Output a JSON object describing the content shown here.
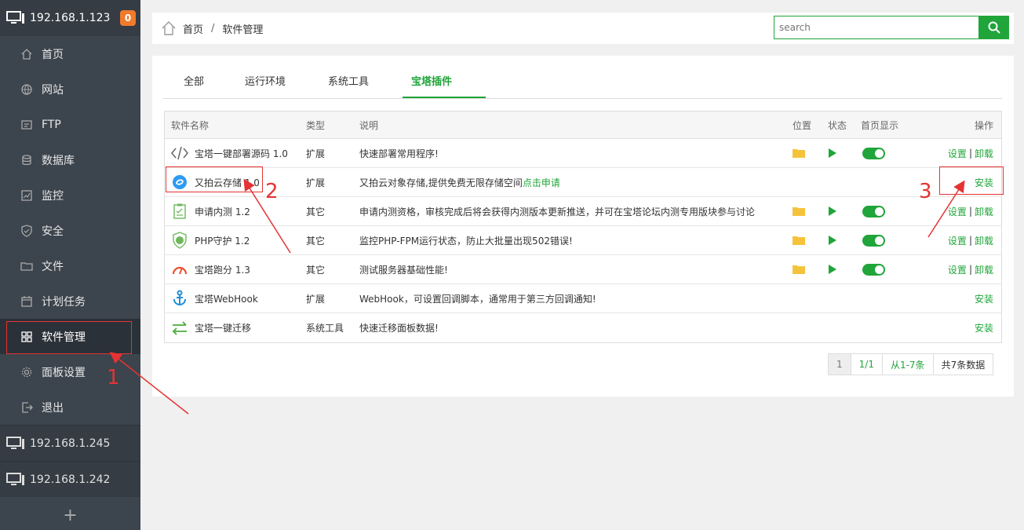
{
  "sidebar": {
    "current_server": "192.168.1.123",
    "badge": "0",
    "items": [
      {
        "label": "首页"
      },
      {
        "label": "网站"
      },
      {
        "label": "FTP"
      },
      {
        "label": "数据库"
      },
      {
        "label": "监控"
      },
      {
        "label": "安全"
      },
      {
        "label": "文件"
      },
      {
        "label": "计划任务"
      },
      {
        "label": "软件管理"
      },
      {
        "label": "面板设置"
      },
      {
        "label": "退出"
      }
    ],
    "other_servers": [
      "192.168.1.245",
      "192.168.1.242"
    ],
    "add_label": "+"
  },
  "breadcrumb": {
    "home": "首页",
    "separator": "/",
    "current": "软件管理"
  },
  "search": {
    "placeholder": "search"
  },
  "tabs": [
    {
      "label": "全部"
    },
    {
      "label": "运行环境"
    },
    {
      "label": "系统工具"
    },
    {
      "label": "宝塔插件",
      "active": true
    }
  ],
  "table": {
    "headers": {
      "name": "软件名称",
      "type": "类型",
      "desc": "说明",
      "location": "位置",
      "status": "状态",
      "home": "首页显示",
      "op": "操作"
    },
    "rows": [
      {
        "name": "宝塔一键部署源码 1.0",
        "type": "扩展",
        "desc": "快速部署常用程序!",
        "desc_link": "",
        "installed": true,
        "icon": "code-icon"
      },
      {
        "name": "又拍云存储 1.0",
        "type": "扩展",
        "desc": "又拍云对象存储,提供免费无限存储空间 ",
        "desc_link": "点击申请",
        "installed": false,
        "icon": "upyun-icon"
      },
      {
        "name": "申请内测 1.2",
        "type": "其它",
        "desc": "申请内测资格，审核完成后将会获得内测版本更新推送，并可在宝塔论坛内测专用版块参与讨论",
        "desc_link": "",
        "installed": true,
        "icon": "clipboard-icon"
      },
      {
        "name": "PHP守护 1.2",
        "type": "其它",
        "desc": "监控PHP-FPM运行状态，防止大批量出现502错误!",
        "desc_link": "",
        "installed": true,
        "icon": "php-shield-icon"
      },
      {
        "name": "宝塔跑分 1.3",
        "type": "其它",
        "desc": "测试服务器基础性能!",
        "desc_link": "",
        "installed": true,
        "icon": "gauge-icon"
      },
      {
        "name": "宝塔WebHook",
        "type": "扩展",
        "desc": "WebHook，可设置回调脚本，通常用于第三方回调通知!",
        "desc_link": "",
        "installed": false,
        "icon": "anchor-icon"
      },
      {
        "name": "宝塔一键迁移",
        "type": "系统工具",
        "desc": "快速迁移面板数据!",
        "desc_link": "",
        "installed": false,
        "icon": "transfer-icon"
      }
    ],
    "op_labels": {
      "settings": "设置",
      "sep": "|",
      "uninstall": "卸载",
      "install": "安装"
    }
  },
  "pagination": {
    "current": "1",
    "pages": "1/1",
    "range": "从1-7条",
    "total": "共7条数据"
  },
  "annotations": {
    "one": "1",
    "two": "2",
    "three": "3"
  },
  "colors": {
    "accent": "#20a53a",
    "sidebar_bg": "#3c444d",
    "badge": "#f07b2c",
    "annotation": "#e53333"
  }
}
